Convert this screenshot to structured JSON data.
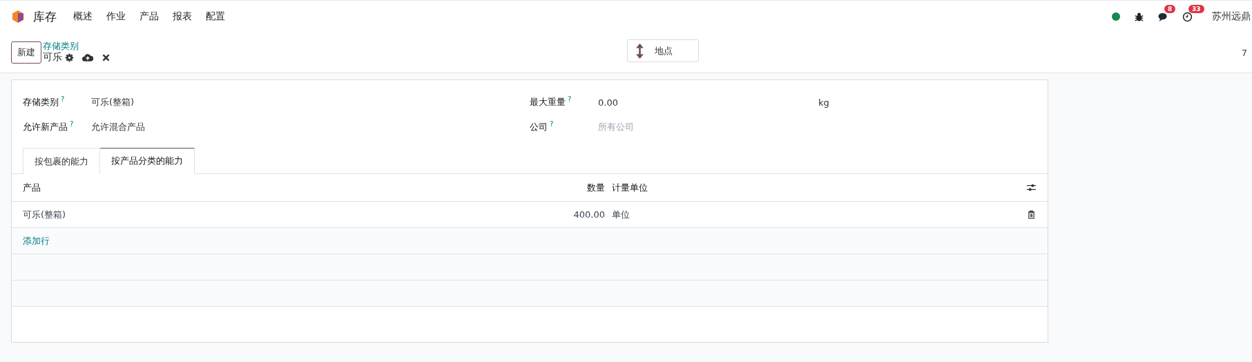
{
  "navbar": {
    "app": "库存",
    "menu": [
      "概述",
      "作业",
      "产品",
      "报表",
      "配置"
    ],
    "online": true,
    "messages_count": "8",
    "activities_count": "33",
    "company": "苏州远鼎"
  },
  "control_panel": {
    "new_button": "新建",
    "breadcrumb": "存储类别",
    "record_title": "可乐",
    "smart_button": "地点",
    "pager": "7"
  },
  "fields_left": [
    {
      "label": "存储类别",
      "help": "?",
      "value": "可乐(整箱)"
    },
    {
      "label": "允许新产品",
      "help": "?",
      "value": "允许混合产品"
    }
  ],
  "fields_right": [
    {
      "label": "最大重量",
      "help": "?",
      "value": "0.00",
      "unit": "kg"
    },
    {
      "label": "公司",
      "help": "?",
      "placeholder": "所有公司"
    }
  ],
  "tabs": [
    {
      "label": "按包裹的能力",
      "selected": false
    },
    {
      "label": "按产品分类的能力",
      "selected": true
    }
  ],
  "table": {
    "columns": [
      "产品",
      "数量",
      "计量单位"
    ],
    "rows": [
      {
        "product": "可乐(整箱)",
        "quantity": "400.00",
        "uom": "单位"
      }
    ],
    "add_line": "添加行"
  }
}
